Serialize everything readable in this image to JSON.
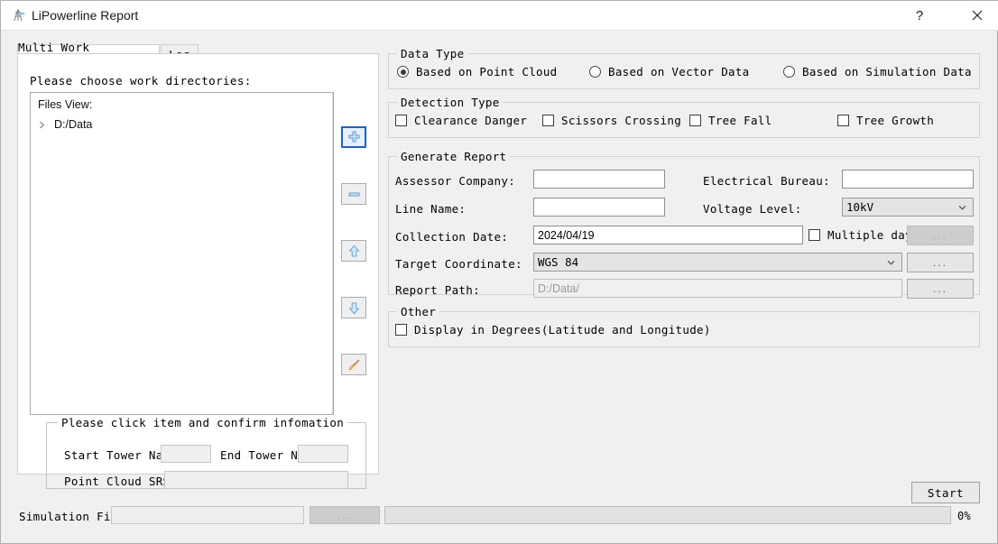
{
  "window": {
    "title": "LiPowerline Report",
    "app_icon": "transmission-tower-icon",
    "help_label": "?",
    "close_label": "✕"
  },
  "left_panel": {
    "tabs": [
      {
        "label": "Multi Work Directories",
        "active": true
      },
      {
        "label": "Log",
        "active": false
      }
    ],
    "choose_label": "Please choose work directories:",
    "files_view": {
      "header": "Files View:",
      "items": [
        {
          "label": "D:/Data",
          "expanded": false
        }
      ]
    },
    "tool_buttons": [
      {
        "name": "add",
        "icon": "plus-icon",
        "focused": true
      },
      {
        "name": "remove",
        "icon": "minus-icon",
        "focused": false
      },
      {
        "name": "move-up",
        "icon": "arrow-up-icon",
        "focused": false
      },
      {
        "name": "move-down",
        "icon": "arrow-down-icon",
        "focused": false
      },
      {
        "name": "edit",
        "icon": "paintbrush-icon",
        "focused": false
      }
    ],
    "confirm_group": {
      "title": "Please click item and confirm infomation",
      "start_tower_label": "Start Tower Name:",
      "start_tower_value": "",
      "end_tower_label": "End Tower Name:",
      "end_tower_value": "",
      "srs_label": "Point Cloud SRS:",
      "srs_value": ""
    }
  },
  "data_type": {
    "title": "Data Type",
    "options": [
      {
        "label": "Based on Point Cloud",
        "selected": true
      },
      {
        "label": "Based on Vector Data",
        "selected": false
      },
      {
        "label": "Based on Simulation Data",
        "selected": false
      }
    ]
  },
  "detection_type": {
    "title": "Detection Type",
    "options": [
      {
        "label": "Clearance Danger",
        "checked": false
      },
      {
        "label": "Scissors Crossing",
        "checked": false
      },
      {
        "label": "Tree Fall",
        "checked": false
      },
      {
        "label": "Tree Growth",
        "checked": false
      }
    ]
  },
  "generate_report": {
    "title": "Generate Report",
    "assessor_company_label": "Assessor Company:",
    "assessor_company_value": "",
    "electrical_bureau_label": "Electrical Bureau:",
    "electrical_bureau_value": "",
    "line_name_label": "Line Name:",
    "line_name_value": "",
    "voltage_level_label": "Voltage Level:",
    "voltage_level_value": "10kV",
    "collection_date_label": "Collection Date:",
    "collection_date_value": "2024/04/19",
    "multiple_days_label": "Multiple days",
    "multiple_days_checked": false,
    "multiple_days_browse_label": "...",
    "target_coordinate_label": "Target Coordinate:",
    "target_coordinate_value": "WGS 84",
    "target_coordinate_browse_label": "...",
    "report_path_label": "Report Path:",
    "report_path_placeholder": "D:/Data/",
    "report_path_browse_label": "..."
  },
  "other": {
    "title": "Other",
    "display_degrees_label": "Display in Degrees(Latitude and Longitude)",
    "display_degrees_checked": false
  },
  "footer": {
    "start_label": "Start",
    "simulation_file_label": "Simulation File:",
    "simulation_file_value": "",
    "simulation_file_browse_label": "...",
    "progress_percent": "0%",
    "progress_value": 0
  }
}
